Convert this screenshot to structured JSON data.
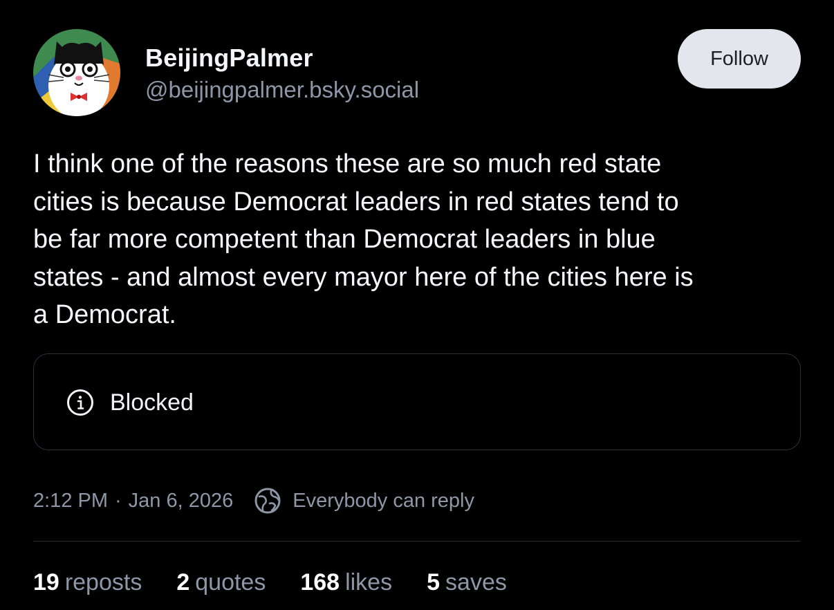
{
  "author": {
    "display_name": "BeijingPalmer",
    "handle": "@beijingpalmer.bsky.social",
    "avatar_icon": "cartoon-cat-avatar"
  },
  "follow_label": "Follow",
  "post_text": "I think one of the reasons these are so much red state\ncities is because Democrat leaders in red states tend to\nbe far more competent than Democrat leaders in blue\nstates - and almost every mayor here of the cities here is\na Democrat.",
  "embed": {
    "label": "Blocked",
    "icon": "info-icon"
  },
  "meta": {
    "time": "2:12 PM",
    "separator": "·",
    "date": "Jan 6, 2026",
    "reply_setting": "Everybody can reply",
    "reply_icon": "globe-icon"
  },
  "stats": {
    "reposts": {
      "count": "19",
      "label": "reposts"
    },
    "quotes": {
      "count": "2",
      "label": "quotes"
    },
    "likes": {
      "count": "168",
      "label": "likes"
    },
    "saves": {
      "count": "5",
      "label": "saves"
    }
  },
  "colors": {
    "background": "#000000",
    "muted_text": "#8f97a6",
    "follow_bg": "#e3e6ec",
    "border": "#2c313a"
  }
}
